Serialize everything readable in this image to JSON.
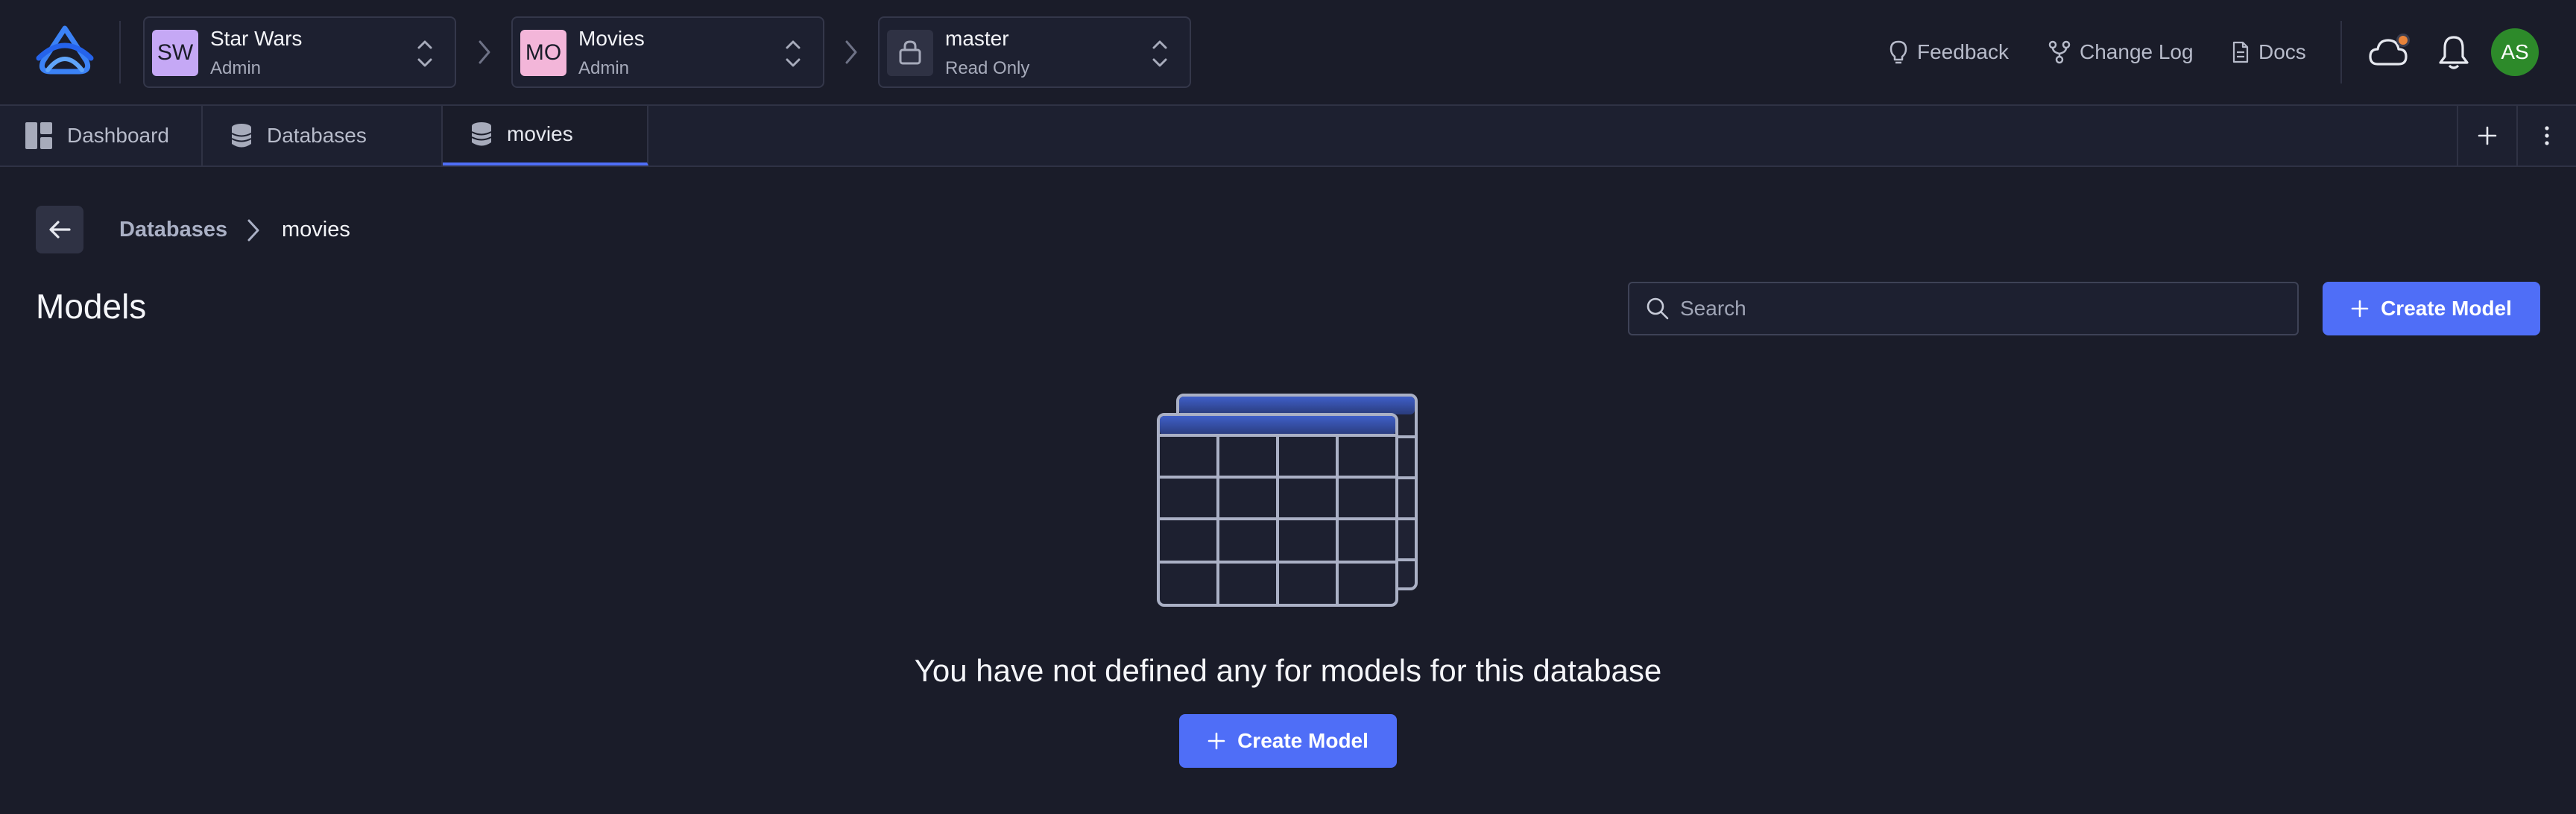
{
  "header": {
    "org": {
      "initials": "SW",
      "name": "Star Wars",
      "role": "Admin",
      "badge_color": "#c5a8f5"
    },
    "project": {
      "initials": "MO",
      "name": "Movies",
      "role": "Admin",
      "badge_color": "#f3b6d9"
    },
    "branch": {
      "name": "master",
      "role": "Read Only",
      "icon": "lock-icon"
    },
    "links": [
      {
        "label": "Feedback",
        "icon": "lightbulb-icon"
      },
      {
        "label": "Change Log",
        "icon": "branch-icon"
      },
      {
        "label": "Docs",
        "icon": "document-icon"
      }
    ],
    "user_initials": "AS",
    "notification_dot_color": "#e8833a"
  },
  "tabs": [
    {
      "label": "Dashboard",
      "icon": "dashboard-icon"
    },
    {
      "label": "Databases",
      "icon": "database-icon"
    },
    {
      "label": "movies",
      "icon": "database-icon",
      "active": true
    }
  ],
  "breadcrumb": {
    "parent": "Databases",
    "current": "movies"
  },
  "main": {
    "title": "Models",
    "search_placeholder": "Search",
    "create_label": "Create Model",
    "empty_message": "You have not defined any for models for this database",
    "empty_create_label": "Create Model"
  },
  "colors": {
    "accent": "#4f6ef7",
    "background": "#1a1c29",
    "avatar": "#2d8a2a"
  }
}
